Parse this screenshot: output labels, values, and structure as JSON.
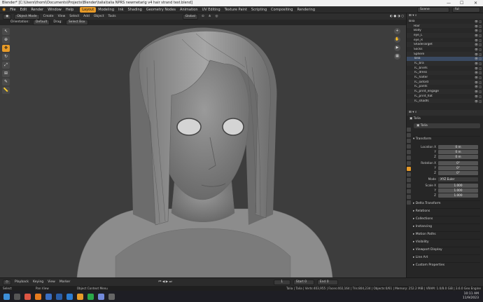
{
  "titlebar": {
    "title": "Blender* [C:\\Users\\thomi\\Documents\\Projects\\Blender\\talia\\talia NPRS newmetarig v4 hair strand test.blend]",
    "minimize": "—",
    "maximize": "☐",
    "close": "✕"
  },
  "menu": {
    "items": [
      "File",
      "Edit",
      "Render",
      "Window",
      "Help"
    ],
    "workspaces": [
      "Layout",
      "Modeling",
      "Ink",
      "Shading",
      "Geometry Nodes",
      "Animation",
      "UV Editing",
      "Texture Paint",
      "Scripting",
      "Compositing",
      "Rendering"
    ],
    "active_workspace": "Layout",
    "scene_label": "Scene",
    "viewlayer_label": "ful"
  },
  "viewport_header": {
    "mode": "Object Mode",
    "menus": [
      "View",
      "Select",
      "Add",
      "Object",
      "Tools"
    ],
    "create_label": "Create",
    "transform_orientation": "Global",
    "orientation_label": "Orientation:",
    "orientation_value": "Default",
    "drag_label": "Drag:",
    "drag_value": "Select Box"
  },
  "outliner": {
    "items": [
      {
        "name": "Talia",
        "icons": ""
      },
      {
        "name": "Hair",
        "icons": ""
      },
      {
        "name": "Body",
        "icons": ""
      },
      {
        "name": "eye_L",
        "icons": ""
      },
      {
        "name": "eye_R",
        "icons": ""
      },
      {
        "name": "ShadeTarget",
        "icons": ""
      },
      {
        "name": "Socks",
        "icons": ""
      },
      {
        "name": "Sphere",
        "icons": ""
      },
      {
        "name": "Talia",
        "icons": ""
      },
      {
        "name": "TC_bra",
        "icons": ""
      },
      {
        "name": "TC_briefs",
        "icons": ""
      },
      {
        "name": "TC_dress",
        "icons": ""
      },
      {
        "name": "TC_halter",
        "icons": ""
      },
      {
        "name": "TC_oxford",
        "icons": ""
      },
      {
        "name": "TC_pants",
        "icons": ""
      },
      {
        "name": "TC_print_engage",
        "icons": ""
      },
      {
        "name": "TC_print_flat",
        "icons": ""
      },
      {
        "name": "TC_shadfs",
        "icons": ""
      }
    ]
  },
  "properties": {
    "object_name_header": "Talia",
    "object_name": "Talia",
    "transform_label": "Transform",
    "location_label": "Location X",
    "location": [
      "0 m",
      "0 m",
      "0 m"
    ],
    "rotation_label": "Rotation X",
    "rotation": [
      "0°",
      "0°",
      "0°"
    ],
    "mode_label": "Mode",
    "mode_value": "XYZ Euler",
    "scale_label": "Scale X",
    "scale": [
      "1.000",
      "1.000",
      "1.000"
    ],
    "axis_y": "Y",
    "axis_z": "Z",
    "sections": [
      "Delta Transform",
      "Relations",
      "Collections",
      "Instancing",
      "Motion Paths",
      "Visibility",
      "Viewport Display",
      "Line Art",
      "Custom Properties"
    ]
  },
  "timeline": {
    "menus": [
      "Playback",
      "Keying",
      "View",
      "Marker"
    ],
    "current_frame": "1",
    "start_label": "Start",
    "start": "0",
    "end_label": "End",
    "end": "0"
  },
  "statusbar": {
    "left": [
      "Select",
      "Pan View",
      "Object Context Menu"
    ],
    "right": "Talia | Talia | Verts:403,955 | Faces:402,164 | Tris:804,234 | Objects:0/61 | Memory: 252.2 MiB | VRAM: 1.0/8.0 GiB | 3.6.0 Geo Engine"
  },
  "taskbar": {
    "time": "10:11 AM",
    "date": "11/9/2023"
  },
  "colors": {
    "accent": "#e89b28",
    "viewport_bg": "#3d3d3d",
    "panel_bg": "#282828"
  }
}
